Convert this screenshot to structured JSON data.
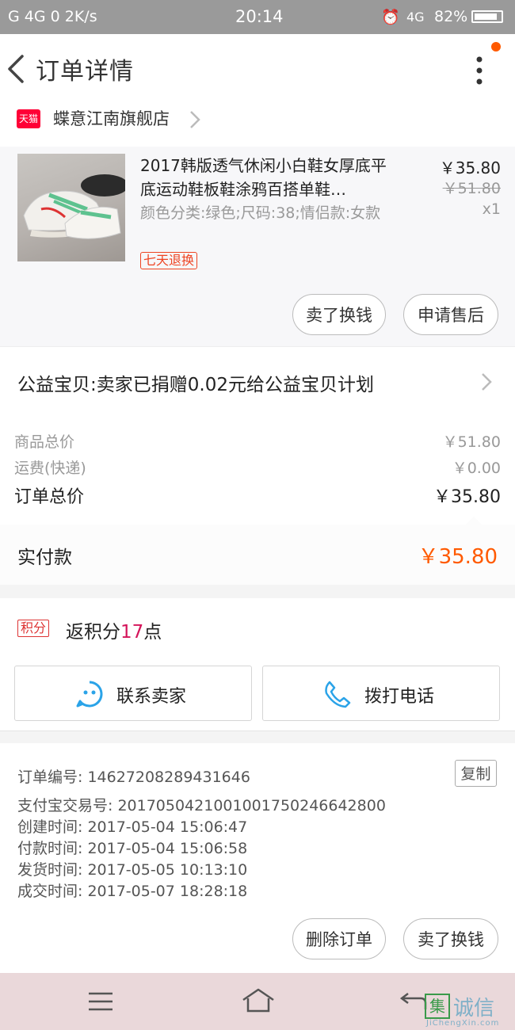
{
  "status_bar": {
    "left": "G 4G 0 2K/s",
    "time": "20:14",
    "network": "4G",
    "battery": "82%"
  },
  "header": {
    "title": "订单详情",
    "back_icon": "chevron-left-icon",
    "menu_icon": "more-vertical-icon",
    "accent": "#ff5a00"
  },
  "shop": {
    "badge": "天猫",
    "name": "蝶意江南旗舰店"
  },
  "product": {
    "name": "2017韩版透气休闲小白鞋女厚底平底运动鞋板鞋涂鸦百搭单鞋…",
    "spec": "颜色分类:绿色;尺码:38;情侣款:女款",
    "badge": "七天退换",
    "price": "￥35.80",
    "original_price": "￥51.80",
    "quantity": "x1"
  },
  "product_actions": {
    "sell_label": "卖了换钱",
    "after_sale_label": "申请售后"
  },
  "charity": {
    "text": "公益宝贝:卖家已捐赠0.02元给公益宝贝计划"
  },
  "price_summary": {
    "goods_label": "商品总价",
    "goods_value": "￥51.80",
    "shipping_label": "运费(快递)",
    "shipping_value": "￥0.00",
    "total_label": "订单总价",
    "total_value": "￥35.80"
  },
  "payment": {
    "label": "实付款",
    "value": "￥35.80"
  },
  "points": {
    "tag": "积分",
    "prefix": "返积分",
    "amount": "17",
    "suffix": "点"
  },
  "contact": {
    "seller_label": "联系卖家",
    "phone_label": "拨打电话"
  },
  "order_info": {
    "copy_label": "复制",
    "lines": [
      "订单编号: 14627208289431646",
      "支付宝交易号: 2017050421001001750246642800",
      "创建时间: 2017-05-04  15:06:47",
      "付款时间: 2017-05-04  15:06:58",
      "发货时间: 2017-05-05  10:13:10",
      "成交时间: 2017-05-07  18:28:18"
    ]
  },
  "bottom_actions": {
    "delete_label": "删除订单",
    "sell_label": "卖了换钱"
  },
  "watermark": {
    "cn": "诚信",
    "box": "集",
    "en": "JiChengXin.com"
  }
}
